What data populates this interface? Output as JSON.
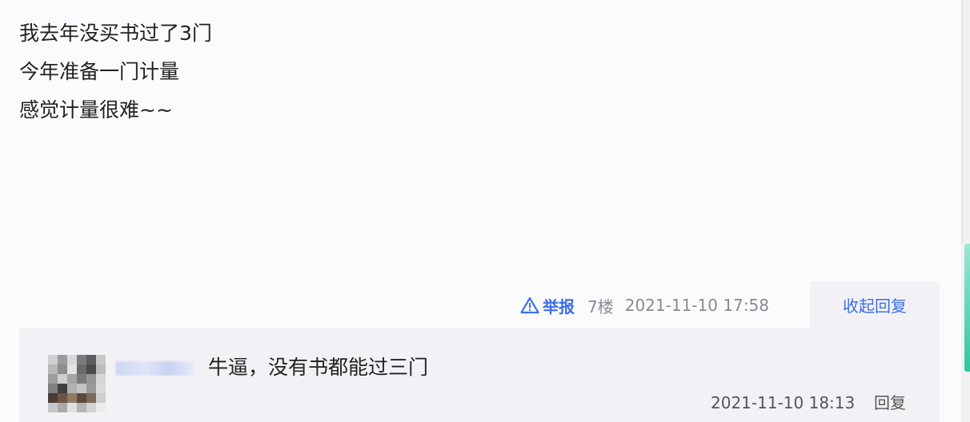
{
  "post": {
    "lines": [
      "我去年没买书过了3门",
      "今年准备一门计量",
      "感觉计量很难~~"
    ],
    "report_label": "举报",
    "floor": "7楼",
    "time": "2021-11-10 17:58",
    "collapse_label": "收起回复"
  },
  "reply": {
    "text": "牛逼，没有书都能过三门",
    "time": "2021-11-10 18:13",
    "reply_label": "回复"
  },
  "colors": {
    "link": "#3b6ee6",
    "reply_bg": "#f2f2f6",
    "page_bg": "#fbfbfd"
  },
  "icons": [
    "warning-triangle-icon"
  ]
}
